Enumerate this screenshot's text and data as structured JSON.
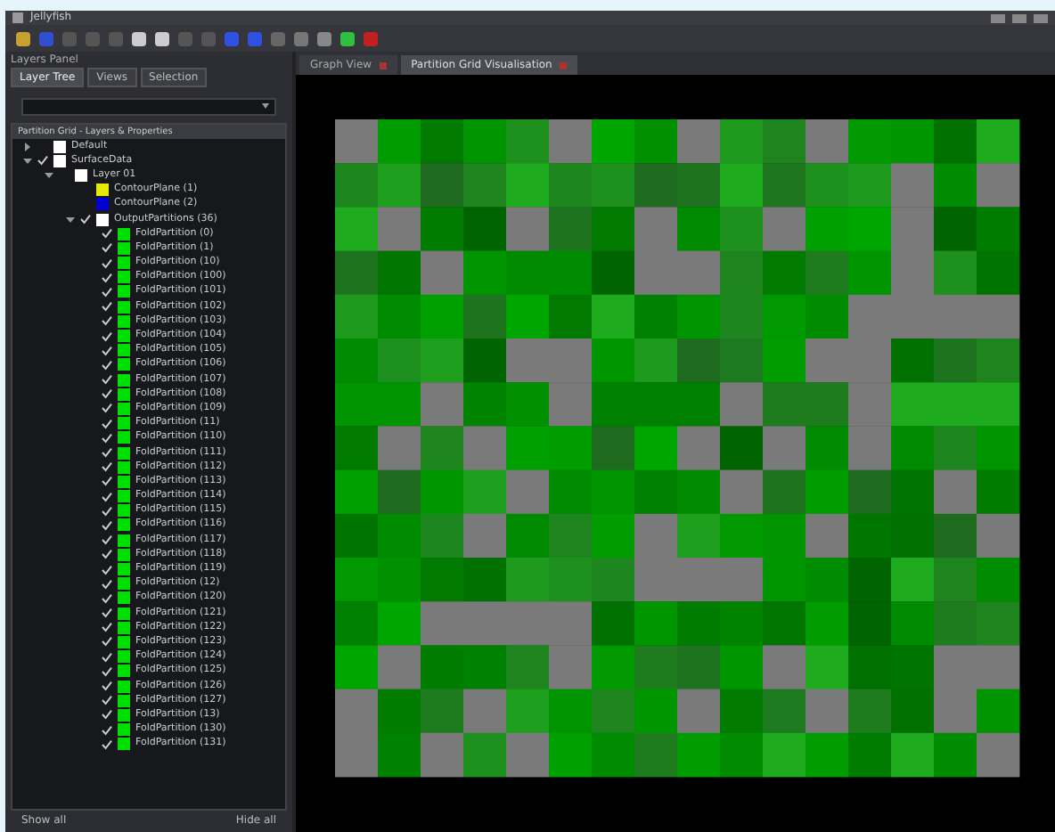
{
  "window": {
    "title": "Jellyfish"
  },
  "left_panel": {
    "header": "Layers Panel",
    "tabs": [
      {
        "label": "Layer Tree",
        "selected": true
      },
      {
        "label": "Views",
        "selected": false
      },
      {
        "label": "Selection",
        "selected": false
      }
    ],
    "tree_header": "Partition Grid - Layers & Properties",
    "tree": [
      {
        "label": "Default",
        "color": "#ffffff",
        "checked": false,
        "expanded": false
      },
      {
        "label": "SurfaceData",
        "color": "#ffffff",
        "checked": true,
        "expanded": true,
        "children": [
          {
            "label": "Layer 01",
            "color": "#ffffff",
            "checked": false,
            "expanded": true,
            "children": [
              {
                "label": "ContourPlane (1)",
                "color": "#e8e800",
                "checked": false
              },
              {
                "label": "ContourPlane (2)",
                "color": "#0000d0",
                "checked": false
              },
              {
                "label": "OutputPartitions (36)",
                "color": "#ffffff",
                "checked": true,
                "expanded": true,
                "children": [
                  {
                    "label": "FoldPartition (0)",
                    "color": "#00e000",
                    "checked": true
                  },
                  {
                    "label": "FoldPartition (1)",
                    "color": "#00e000",
                    "checked": true
                  },
                  {
                    "label": "FoldPartition (10)",
                    "color": "#00e000",
                    "checked": true
                  },
                  {
                    "label": "FoldPartition (100)",
                    "color": "#00e000",
                    "checked": true
                  },
                  {
                    "label": "FoldPartition (101)",
                    "color": "#00e000",
                    "checked": true
                  },
                  {
                    "label": "FoldPartition (102)",
                    "color": "#00e000",
                    "checked": true
                  },
                  {
                    "label": "FoldPartition (103)",
                    "color": "#00e000",
                    "checked": true
                  },
                  {
                    "label": "FoldPartition (104)",
                    "color": "#00e000",
                    "checked": true
                  },
                  {
                    "label": "FoldPartition (105)",
                    "color": "#00e000",
                    "checked": true
                  },
                  {
                    "label": "FoldPartition (106)",
                    "color": "#00e000",
                    "checked": true
                  },
                  {
                    "label": "FoldPartition (107)",
                    "color": "#00e000",
                    "checked": true
                  },
                  {
                    "label": "FoldPartition (108)",
                    "color": "#00e000",
                    "checked": true
                  },
                  {
                    "label": "FoldPartition (109)",
                    "color": "#00e000",
                    "checked": true
                  },
                  {
                    "label": "FoldPartition (11)",
                    "color": "#00e000",
                    "checked": true
                  },
                  {
                    "label": "FoldPartition (110)",
                    "color": "#00e000",
                    "checked": true
                  },
                  {
                    "label": "FoldPartition (111)",
                    "color": "#00e000",
                    "checked": true
                  },
                  {
                    "label": "FoldPartition (112)",
                    "color": "#00e000",
                    "checked": true
                  },
                  {
                    "label": "FoldPartition (113)",
                    "color": "#00e000",
                    "checked": true
                  },
                  {
                    "label": "FoldPartition (114)",
                    "color": "#00e000",
                    "checked": true
                  },
                  {
                    "label": "FoldPartition (115)",
                    "color": "#00e000",
                    "checked": true
                  },
                  {
                    "label": "FoldPartition (116)",
                    "color": "#00e000",
                    "checked": true
                  },
                  {
                    "label": "FoldPartition (117)",
                    "color": "#00e000",
                    "checked": true
                  },
                  {
                    "label": "FoldPartition (118)",
                    "color": "#00e000",
                    "checked": true
                  },
                  {
                    "label": "FoldPartition (119)",
                    "color": "#00e000",
                    "checked": true
                  },
                  {
                    "label": "FoldPartition (12)",
                    "color": "#00e000",
                    "checked": true
                  },
                  {
                    "label": "FoldPartition (120)",
                    "color": "#00e000",
                    "checked": true
                  },
                  {
                    "label": "FoldPartition (121)",
                    "color": "#00e000",
                    "checked": true
                  },
                  {
                    "label": "FoldPartition (122)",
                    "color": "#00e000",
                    "checked": true
                  },
                  {
                    "label": "FoldPartition (123)",
                    "color": "#00e000",
                    "checked": true
                  },
                  {
                    "label": "FoldPartition (124)",
                    "color": "#00e000",
                    "checked": true
                  },
                  {
                    "label": "FoldPartition (125)",
                    "color": "#00e000",
                    "checked": true
                  },
                  {
                    "label": "FoldPartition (126)",
                    "color": "#00e000",
                    "checked": true
                  },
                  {
                    "label": "FoldPartition (127)",
                    "color": "#00e000",
                    "checked": true
                  },
                  {
                    "label": "FoldPartition (13)",
                    "color": "#00e000",
                    "checked": true
                  },
                  {
                    "label": "FoldPartition (130)",
                    "color": "#00e000",
                    "checked": true
                  },
                  {
                    "label": "FoldPartition (131)",
                    "color": "#00e000",
                    "checked": true
                  }
                ]
              }
            ]
          }
        ]
      }
    ],
    "footer": {
      "left": "Show all",
      "right": "Hide all"
    }
  },
  "main_tabs": [
    {
      "label": "Graph View",
      "selected": false
    },
    {
      "label": "Partition Grid Visualisation",
      "selected": true
    }
  ]
}
